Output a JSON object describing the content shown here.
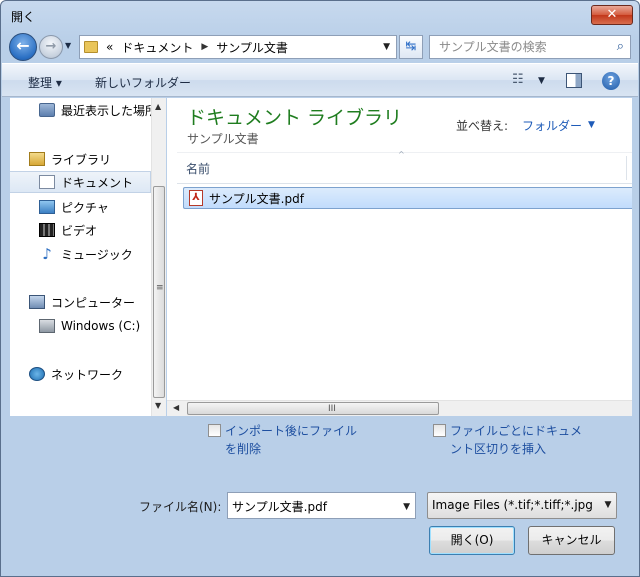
{
  "window": {
    "title": "開く",
    "close_glyph": "✕"
  },
  "navigation": {
    "back_glyph": "←",
    "forward_glyph": "→",
    "history_drop_glyph": "▼",
    "breadcrumb": {
      "overflow": "«",
      "items": [
        "ドキュメント",
        "サンプル文書"
      ],
      "separator": "▶"
    },
    "address_drop_glyph": "▼",
    "refresh_glyph": "↹",
    "search": {
      "placeholder": "サンプル文書の検索",
      "glyph": "⌕"
    }
  },
  "toolbar": {
    "organize_label": "整理 ▾",
    "new_folder_label": "新しいフォルダー",
    "view_glyph": "☷",
    "view_drop_glyph": "▼",
    "help_glyph": "?"
  },
  "sidebar": {
    "items": [
      {
        "label": "最近表示した場所",
        "icon": "recent-places-icon"
      },
      {
        "label": "ライブラリ",
        "icon": "library-icon"
      },
      {
        "label": "ドキュメント",
        "icon": "documents-icon"
      },
      {
        "label": "ピクチャ",
        "icon": "pictures-icon"
      },
      {
        "label": "ビデオ",
        "icon": "videos-icon"
      },
      {
        "label": "ミュージック",
        "icon": "music-icon"
      },
      {
        "label": "コンピューター",
        "icon": "computer-icon"
      },
      {
        "label": "Windows (C:)",
        "icon": "drive-icon"
      },
      {
        "label": "ネットワーク",
        "icon": "network-icon"
      }
    ],
    "music_glyph": "♪",
    "scroll_up_glyph": "▲",
    "scroll_down_glyph": "▼",
    "scroll_grip_glyph": "≡"
  },
  "main": {
    "library_title": "ドキュメント ライブラリ",
    "library_subtitle": "サンプル文書",
    "sort_label": "並べ替え:",
    "sort_value": "フォルダー",
    "sort_drop_glyph": "▼",
    "column_header": "名前",
    "column_sort_glyph": "^",
    "files": [
      {
        "name": "サンプル文書.pdf",
        "icon": "pdf-icon",
        "icon_glyph": "⅄"
      }
    ],
    "hscroll_left_glyph": "◀",
    "hscroll_grip_glyph": "III"
  },
  "options": {
    "import_delete_label": "インポート後にファイルを削除",
    "insert_separator_label": "ファイルごとにドキュメント区切りを挿入"
  },
  "footer": {
    "filename_label": "ファイル名(N):",
    "filename_value": "サンプル文書.pdf",
    "filename_drop_glyph": "▼",
    "filter_value": "Image Files (*.tif;*.tiff;*.jpg",
    "filter_drop_glyph": "▼",
    "open_label": "開く(O)",
    "cancel_label": "キャンセル"
  },
  "colors": {
    "library_title": "#1f7d1f",
    "link": "#1e5bb8",
    "selection": "#c1dcfc",
    "close_button": "#c2371a"
  }
}
